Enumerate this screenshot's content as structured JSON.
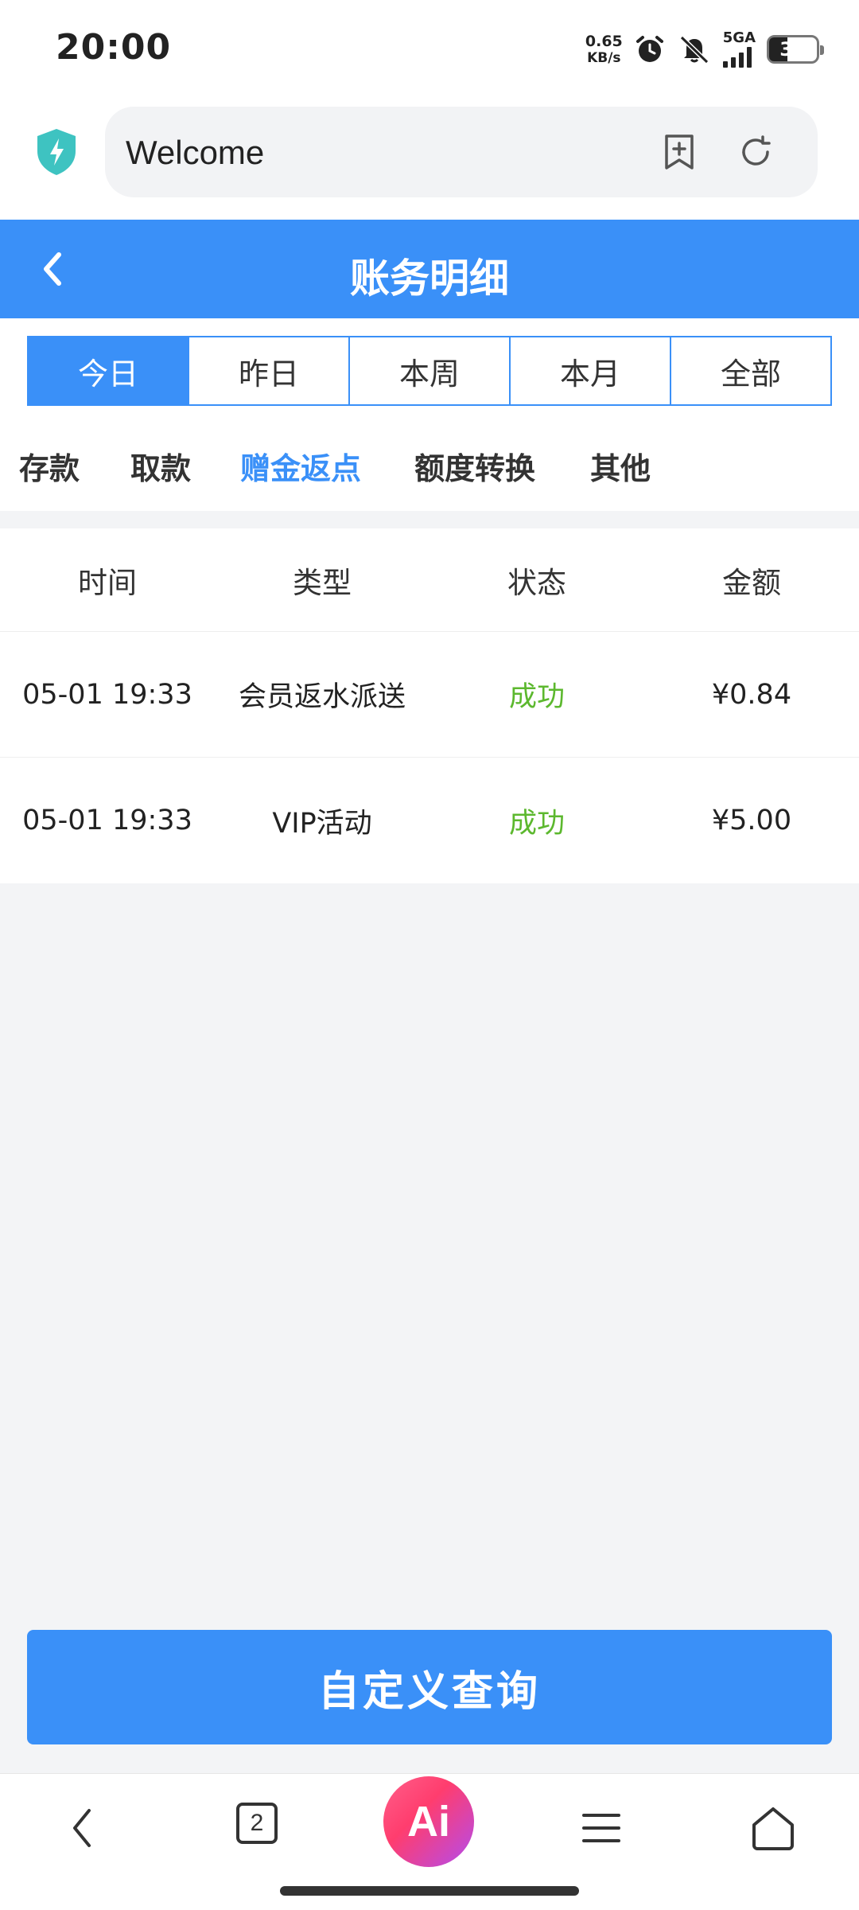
{
  "status_bar": {
    "time": "20:00",
    "net_speed_value": "0.65",
    "net_speed_unit": "KB/s",
    "network_label": "5GA",
    "battery_level": "39"
  },
  "browser": {
    "address_text": "Welcome"
  },
  "header": {
    "title": "账务明细"
  },
  "period_tabs": [
    {
      "label": "今日",
      "active": true
    },
    {
      "label": "昨日",
      "active": false
    },
    {
      "label": "本周",
      "active": false
    },
    {
      "label": "本月",
      "active": false
    },
    {
      "label": "全部",
      "active": false
    }
  ],
  "category_tabs": [
    {
      "label": "存款",
      "active": false
    },
    {
      "label": "取款",
      "active": false
    },
    {
      "label": "赠金返点",
      "active": true
    },
    {
      "label": "额度转换",
      "active": false
    },
    {
      "label": "其他",
      "active": false
    }
  ],
  "table": {
    "headers": [
      "时间",
      "类型",
      "状态",
      "金额"
    ],
    "rows": [
      {
        "time": "05-01 19:33",
        "type": "会员返水派送",
        "status": "成功",
        "amount": "¥0.84"
      },
      {
        "time": "05-01 19:33",
        "type": "VIP活动",
        "status": "成功",
        "amount": "¥5.00"
      }
    ]
  },
  "query_button": "自定义查询",
  "bottom_nav": {
    "tab_count": "2",
    "ai_label": "Ai"
  },
  "colors": {
    "accent": "#3a90f8",
    "success": "#5cb82e"
  }
}
